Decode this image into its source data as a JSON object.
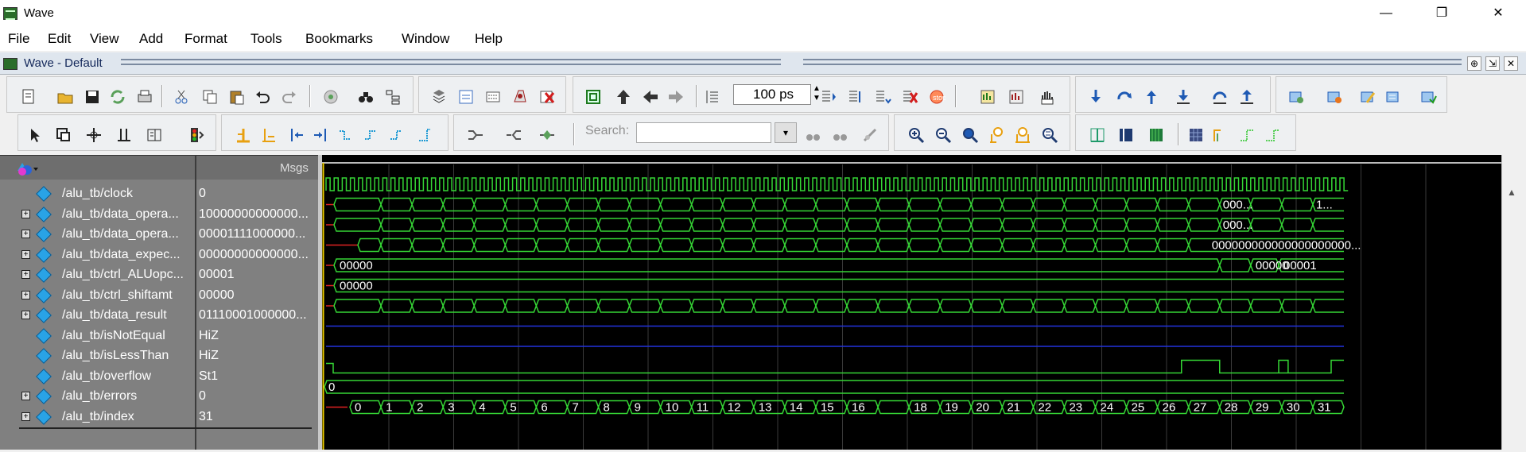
{
  "window": {
    "title": "Wave",
    "minimize": "—",
    "maximize": "❐",
    "close": "✕"
  },
  "menu": [
    "File",
    "Edit",
    "View",
    "Add",
    "Format",
    "Tools",
    "Bookmarks",
    "Window",
    "Help"
  ],
  "pane": {
    "title": "Wave - Default",
    "msgs_header": "Msgs"
  },
  "toolbar": {
    "run_length": "100 ps",
    "search_label": "Search:",
    "search_value": ""
  },
  "signals": [
    {
      "name": "/alu_tb/clock",
      "value": "0",
      "expandable": false
    },
    {
      "name": "/alu_tb/data_opera...",
      "value": "10000000000000...",
      "expandable": true
    },
    {
      "name": "/alu_tb/data_opera...",
      "value": "00001111000000...",
      "expandable": true
    },
    {
      "name": "/alu_tb/data_expec...",
      "value": "00000000000000...",
      "expandable": true
    },
    {
      "name": "/alu_tb/ctrl_ALUopc...",
      "value": "00001",
      "expandable": true
    },
    {
      "name": "/alu_tb/ctrl_shiftamt",
      "value": "00000",
      "expandable": true
    },
    {
      "name": "/alu_tb/data_result",
      "value": "01110001000000...",
      "expandable": true
    },
    {
      "name": "/alu_tb/isNotEqual",
      "value": "HiZ",
      "expandable": false
    },
    {
      "name": "/alu_tb/isLessThan",
      "value": "HiZ",
      "expandable": false
    },
    {
      "name": "/alu_tb/overflow",
      "value": "St1",
      "expandable": false
    },
    {
      "name": "/alu_tb/errors",
      "value": "0",
      "expandable": true
    },
    {
      "name": "/alu_tb/index",
      "value": "31",
      "expandable": true
    }
  ],
  "wave_labels": {
    "op_a": [
      "000...",
      "1..."
    ],
    "op_b": [
      "000..."
    ],
    "expected": [
      "000000000000000000000..."
    ],
    "aluop": [
      "00000",
      "00000",
      "00001"
    ],
    "shiftamt": [
      "00000"
    ],
    "errors": [
      "0"
    ],
    "index": [
      "0",
      "1",
      "2",
      "3",
      "4",
      "5",
      "6",
      "7",
      "8",
      "9",
      "10",
      "11",
      "12",
      "13",
      "14",
      "15",
      "16",
      "",
      "18",
      "19",
      "20",
      "21",
      "22",
      "23",
      "24",
      "25",
      "26",
      "27",
      "28",
      "29",
      "30",
      "31"
    ]
  },
  "colors": {
    "wave": "#35d635",
    "hiz": "#2233dd",
    "cursor": "#f0d000",
    "pane_bg": "#000000",
    "label_bg": "#808080"
  }
}
